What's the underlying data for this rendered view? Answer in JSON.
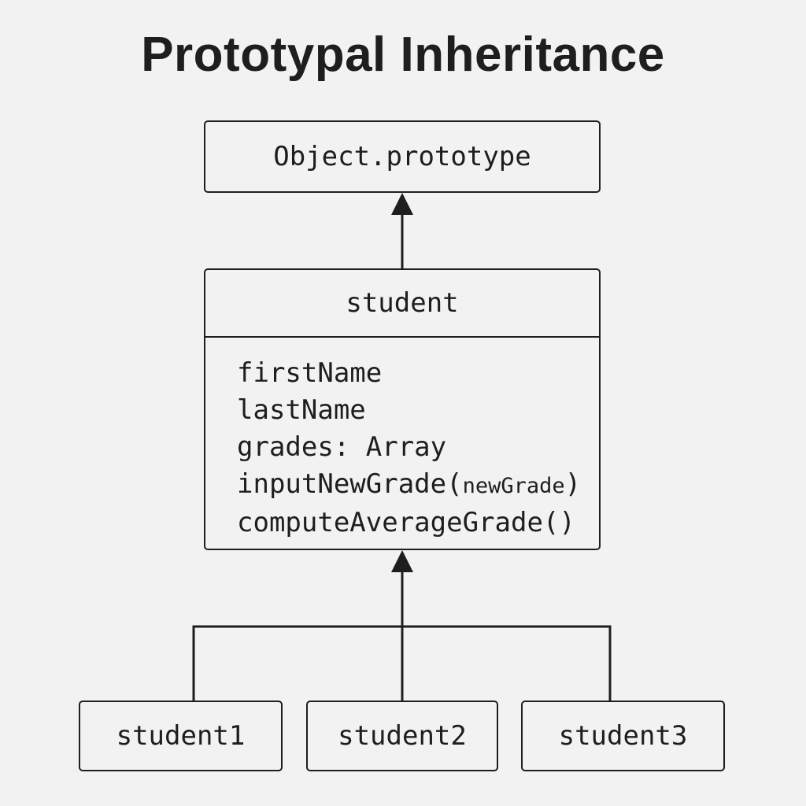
{
  "title": "Prototypal Inheritance",
  "prototype_box": {
    "label": "Object.prototype"
  },
  "student_box": {
    "name": "student",
    "members": [
      {
        "text": "firstName"
      },
      {
        "text": "lastName"
      },
      {
        "text": "grades: Array"
      },
      {
        "text": "inputNewGrade(",
        "small": "newGrade",
        "suffix": ")"
      },
      {
        "text": "computeAverageGrade()"
      }
    ]
  },
  "instances": [
    "student1",
    "student2",
    "student3"
  ],
  "colors": {
    "background": "#f2f2f2",
    "stroke": "#1e1e1e"
  }
}
